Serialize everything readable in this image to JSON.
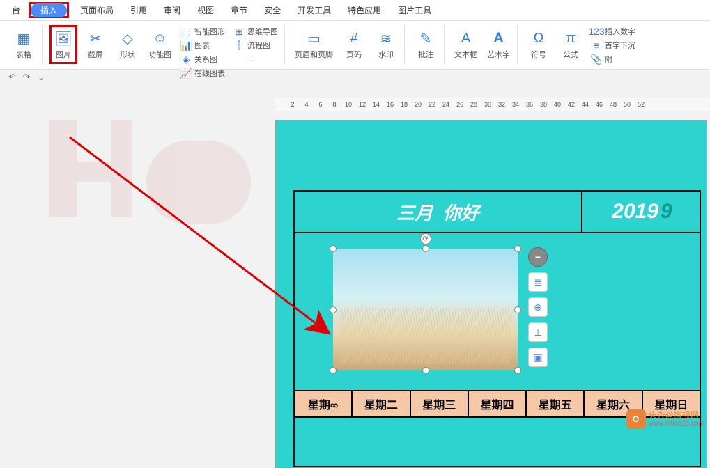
{
  "tabs": {
    "prefix": "台",
    "insert": "插入",
    "items": [
      "页面布局",
      "引用",
      "审阅",
      "视图",
      "章节",
      "安全",
      "开发工具",
      "特色应用",
      "图片工具"
    ]
  },
  "ribbon": {
    "table": "表格",
    "picture": "图片",
    "screenshot": "截屏",
    "shape": "形状",
    "icon": "功能图",
    "smartart": "智能图形",
    "chart": "图表",
    "relation": "关系图",
    "online": "在线图表",
    "mindmap": "思维导图",
    "flowchart": "流程图",
    "more": "…",
    "headerfooter": "页眉和页脚",
    "pagenum": "页码",
    "watermark": "水印",
    "comment": "批注",
    "textbox": "文本框",
    "wordart": "艺术字",
    "symbol": "符号",
    "equation": "公式",
    "insertnum": "插入数字",
    "firstdrop": "首字下沉",
    "attach": "附"
  },
  "qat": {
    "undo": "↶",
    "redo": "↷",
    "more": "⌄"
  },
  "ruler": [
    2,
    4,
    6,
    8,
    10,
    12,
    14,
    16,
    18,
    20,
    22,
    24,
    26,
    28,
    30,
    32,
    34,
    36,
    38,
    40,
    42,
    44,
    46,
    48,
    50,
    52
  ],
  "doc": {
    "title_month": "三月",
    "title_hello": "你好",
    "year": "2019",
    "weekdays": [
      "星期∞",
      "星期二",
      "星期三",
      "星期四",
      "星期五",
      "星期六",
      "星期日"
    ]
  },
  "corner": {
    "text": "头条@情报网",
    "url": "www.office26.com"
  }
}
